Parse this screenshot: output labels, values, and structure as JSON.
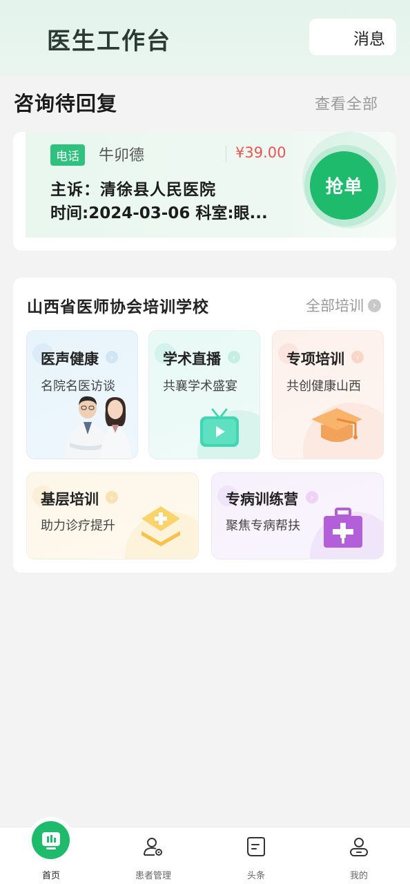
{
  "header": {
    "title": "医生工作台",
    "message_label": "消息"
  },
  "consult": {
    "section_title": "咨询待回复",
    "view_all": "查看全部",
    "card": {
      "tag": "电话",
      "patient_name": "牛卯德",
      "price": "¥39.00",
      "complaint": "主诉：清徐县人民医院",
      "time_dept": "时间:2024-03-06  科室:眼...",
      "grab_label": "抢单"
    }
  },
  "training": {
    "title": "山西省医师协会培训学校",
    "all_label": "全部培训",
    "tiles": [
      {
        "name": "医声健康",
        "sub": "名院名医访谈",
        "icon": "doctors-photo"
      },
      {
        "name": "学术直播",
        "sub": "共襄学术盛宴",
        "icon": "tv-icon"
      },
      {
        "name": "专项培训",
        "sub": "共创健康山西",
        "icon": "graduation-cap-icon"
      },
      {
        "name": "基层培训",
        "sub": "助力诊疗提升",
        "icon": "layers-plus-icon"
      },
      {
        "name": "专病训练营",
        "sub": "聚焦专病帮扶",
        "icon": "medical-kit-icon"
      }
    ]
  },
  "nav": {
    "items": [
      {
        "label": "首页",
        "icon": "home-chart-icon",
        "active": true
      },
      {
        "label": "患者管理",
        "icon": "patient-manage-icon",
        "active": false
      },
      {
        "label": "头条",
        "icon": "news-icon",
        "active": false
      },
      {
        "label": "我的",
        "icon": "profile-icon",
        "active": false
      }
    ]
  },
  "colors": {
    "brand_green": "#1dbb6b",
    "price_red": "#e8554e"
  }
}
